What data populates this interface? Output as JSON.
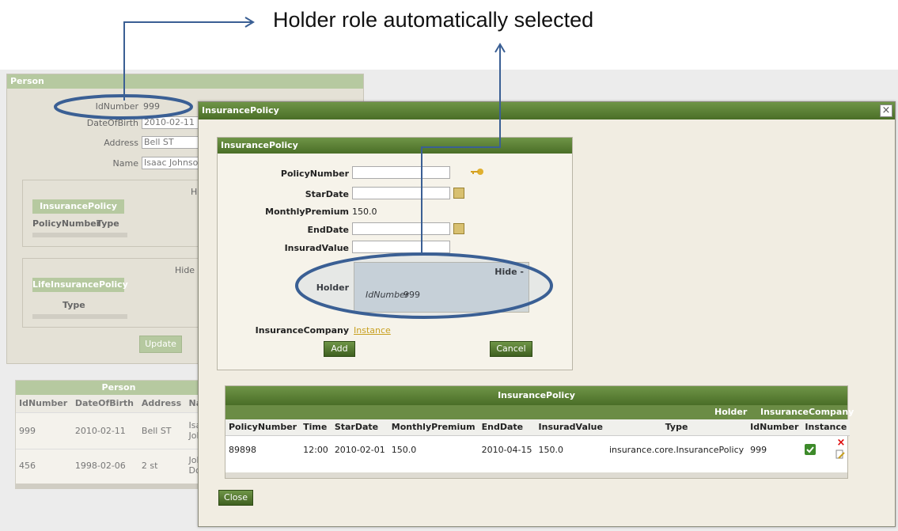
{
  "annotation": {
    "title": "Holder role automatically selected"
  },
  "person_form": {
    "title": "Person",
    "idnumber_label": "IdNumber",
    "idnumber_value": "999",
    "dob_label": "DateOfBirth",
    "dob_value": "2010-02-11",
    "address_label": "Address",
    "address_value": "Bell ST",
    "name_label": "Name",
    "name_value": "Isaac Johnso",
    "insurance_section": {
      "hide_label": "H",
      "tab_label": "InsurancePolicy",
      "col1": "PolicyNumber",
      "col2": "Type"
    },
    "life_section": {
      "hide_label": "Hide",
      "tab_label": "LifeInsurancePolicy",
      "col1": "Type"
    },
    "update_label": "Update"
  },
  "person_table": {
    "title": "Person",
    "headers": [
      "IdNumber",
      "DateOfBirth",
      "Address",
      "Nam"
    ],
    "rows": [
      {
        "id": "999",
        "dob": "2010-02-11",
        "address": "Bell ST",
        "name1": "Isaac",
        "name2": "Johnso"
      },
      {
        "id": "456",
        "dob": "1998-02-06",
        "address": "2 st",
        "name1": "John",
        "name2": "Doe"
      }
    ]
  },
  "dialog": {
    "title": "InsurancePolicy",
    "close_glyph": "×",
    "form": {
      "title": "InsurancePolicy",
      "policy_number_label": "PolicyNumber",
      "policy_number_value": "",
      "star_date_label": "StarDate",
      "star_date_value": "",
      "monthly_label": "MonthlyPremium",
      "monthly_value": "150.0",
      "end_date_label": "EndDate",
      "end_date_value": "",
      "insurad_label": "InsuradValue",
      "insurad_value": "",
      "holder_label": "Holder",
      "holder_hide": "Hide -",
      "holder_id_label": "IdNumber",
      "holder_id_value": "999",
      "company_label": "InsuranceCompany",
      "company_link": "Instance",
      "add_label": "Add",
      "cancel_label": "Cancel"
    },
    "table": {
      "title": "InsurancePolicy",
      "group_holder": "Holder",
      "group_company": "InsuranceCompany",
      "headers": [
        "PolicyNumber",
        "Time",
        "StarDate",
        "MonthlyPremium",
        "EndDate",
        "InsuradValue",
        "Type",
        "IdNumber",
        "Instance"
      ],
      "row": {
        "policy": "89898",
        "time": "12:00",
        "start": "2010-02-01",
        "premium": "150.0",
        "end": "2010-04-15",
        "value": "150.0",
        "type": "insurance.core.InsurancePolicy",
        "idnumber": "999"
      }
    },
    "close_label": "Close"
  },
  "colors": {
    "accent_green": "#6b8c45",
    "annotation_blue": "#3a5f94",
    "dialog_bg": "#f1ede2"
  }
}
